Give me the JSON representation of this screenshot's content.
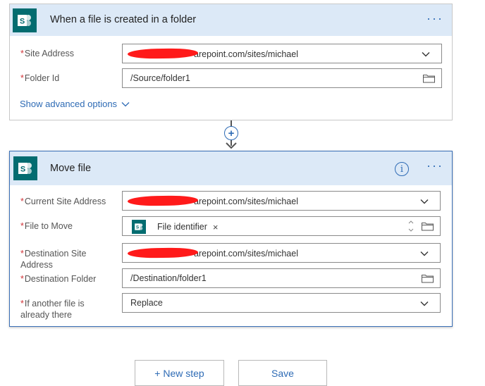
{
  "trigger": {
    "title": "When a file is created in a folder",
    "more_label": "···",
    "fields": {
      "site_address": {
        "label": "Site Address",
        "value": "arepoint.com/sites/michael"
      },
      "folder_id": {
        "label": "Folder Id",
        "value": "/Source/folder1"
      }
    },
    "advanced_label": "Show advanced options"
  },
  "connector": {
    "plus": "+"
  },
  "action": {
    "title": "Move file",
    "info": "i",
    "more_label": "···",
    "fields": {
      "current_site": {
        "label": "Current Site Address",
        "value": "arepoint.com/sites/michael"
      },
      "file_to_move": {
        "label": "File to Move",
        "token": "File identifier",
        "token_remove": "×"
      },
      "dest_site": {
        "label": "Destination Site Address",
        "value": "arepoint.com/sites/michael"
      },
      "dest_folder": {
        "label": "Destination Folder",
        "value": "/Destination/folder1"
      },
      "if_exists": {
        "label": "If another file is already there",
        "value": "Replace"
      }
    }
  },
  "buttons": {
    "new_step": "+ New step",
    "save": "Save"
  },
  "required_marker": "*",
  "colors": {
    "accent": "#2e6bb5",
    "header_bg": "#dce9f7",
    "sharepoint": "#036c70",
    "required": "#d13438"
  },
  "icons": [
    "sharepoint-icon",
    "chevron-down-icon",
    "folder-icon",
    "info-icon",
    "more-icon",
    "plus-icon",
    "stepper-icon"
  ]
}
